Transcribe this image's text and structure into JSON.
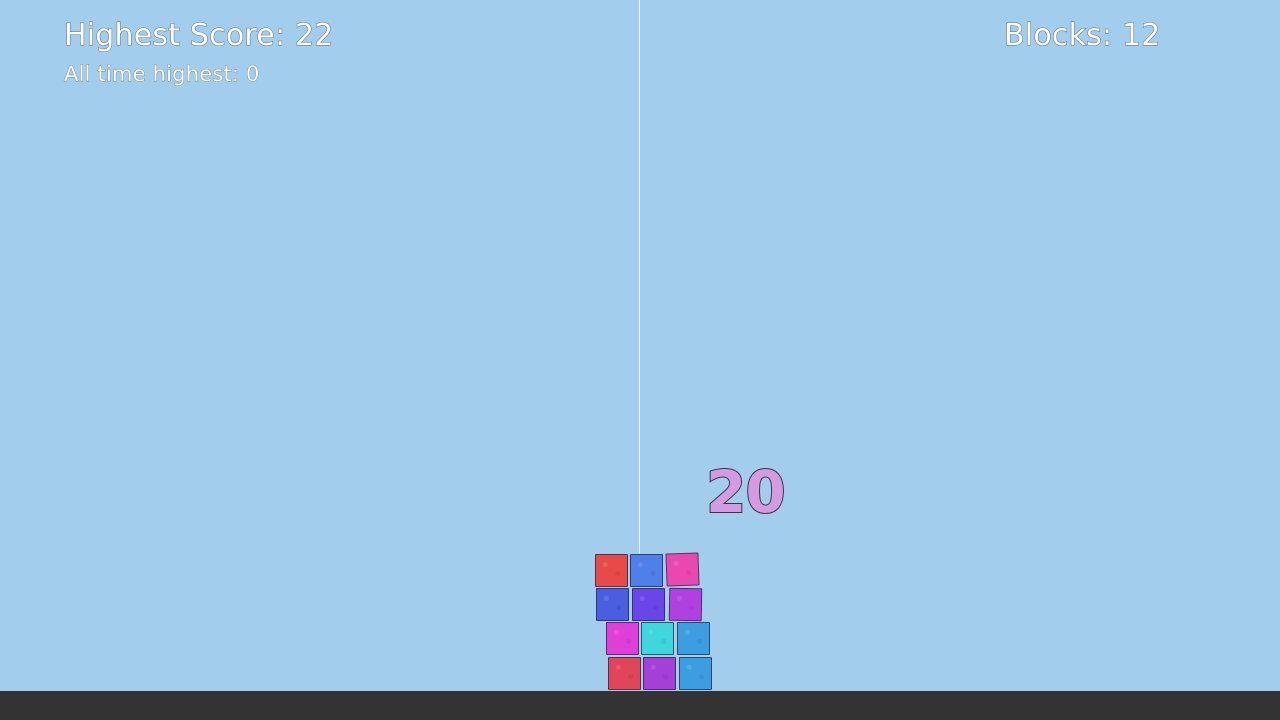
{
  "hud": {
    "highest_score": "Highest Score: 22",
    "all_time_highest": "All time highest: 0",
    "blocks": "Blocks: 12"
  },
  "score_popup": "20",
  "blocks": [
    {
      "color": "#e0455a",
      "row": 1,
      "col": 1
    },
    {
      "color": "#a43fd8",
      "row": 1,
      "col": 2
    },
    {
      "color": "#3c9ee0",
      "row": 1,
      "col": 3
    },
    {
      "color": "#e03ed8",
      "row": 2,
      "col": 1
    },
    {
      "color": "#3fd6dc",
      "row": 2,
      "col": 2
    },
    {
      "color": "#3c9ee0",
      "row": 2,
      "col": 3
    },
    {
      "color": "#4a5ee0",
      "row": 3,
      "col": 1
    },
    {
      "color": "#6a45e8",
      "row": 3,
      "col": 2
    },
    {
      "color": "#b041e0",
      "row": 3,
      "col": 3
    },
    {
      "color": "#e84a4a",
      "row": 4,
      "col": 1
    },
    {
      "color": "#4f7fe8",
      "row": 4,
      "col": 2
    },
    {
      "color": "#e848b0",
      "row": 4,
      "col": 3
    }
  ]
}
